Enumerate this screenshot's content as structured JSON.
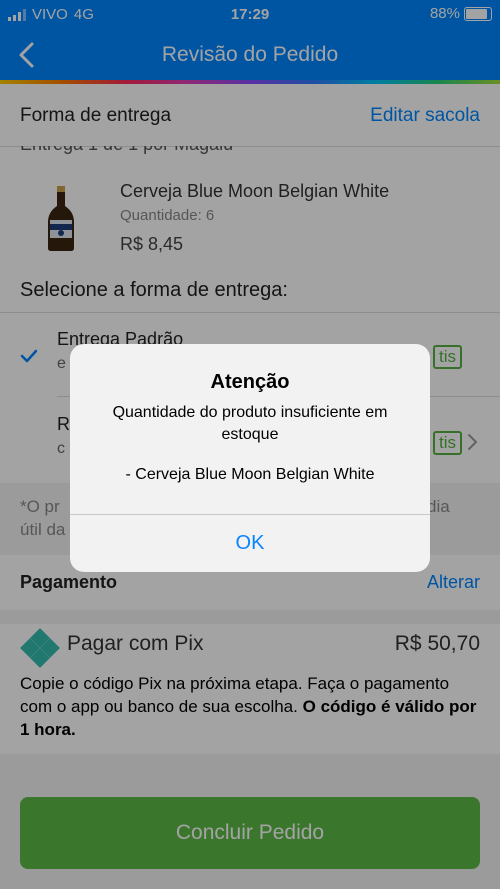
{
  "status_bar": {
    "carrier": "VIVO",
    "network": "4G",
    "time": "17:29",
    "battery": "88%"
  },
  "header": {
    "title": "Revisão do Pedido"
  },
  "delivery": {
    "section_title": "Forma de entrega",
    "edit_link": "Editar sacola",
    "partial_text": "Entrega 1 de 1 por Magalu",
    "product": {
      "name": "Cerveja Blue Moon Belgian White",
      "quantity": "Quantidade: 6",
      "price": "R$ 8,45"
    },
    "select_title": "Selecione a forma de entrega:",
    "options": [
      {
        "label": "Entrega Padrão",
        "sub": "e",
        "badge": "tis"
      },
      {
        "label": "R",
        "sub": "c",
        "badge": "tis"
      }
    ],
    "note_line1": "*O pr",
    "note_line1_right": "dia",
    "note_line2": "útil da"
  },
  "payment": {
    "section_title": "Pagamento",
    "change_link": "Alterar",
    "method": "Pagar com Pix",
    "amount": "R$ 50,70",
    "desc_normal": "Copie o código Pix na próxima etapa. Faça o pagamento com o app ou banco de sua escolha.",
    "desc_bold_1": "O",
    "desc_bold_2": "código é válido por 1 hora."
  },
  "finish_button": "Concluir Pedido",
  "alert": {
    "title": "Atenção",
    "message": "Quantidade do produto insuficiente em estoque",
    "item": "- Cerveja Blue Moon Belgian White",
    "ok": "OK"
  },
  "colors": {
    "brand_blue": "#0086ff",
    "green": "#5cba47",
    "overlay": "rgba(0,0,0,0.36)"
  }
}
